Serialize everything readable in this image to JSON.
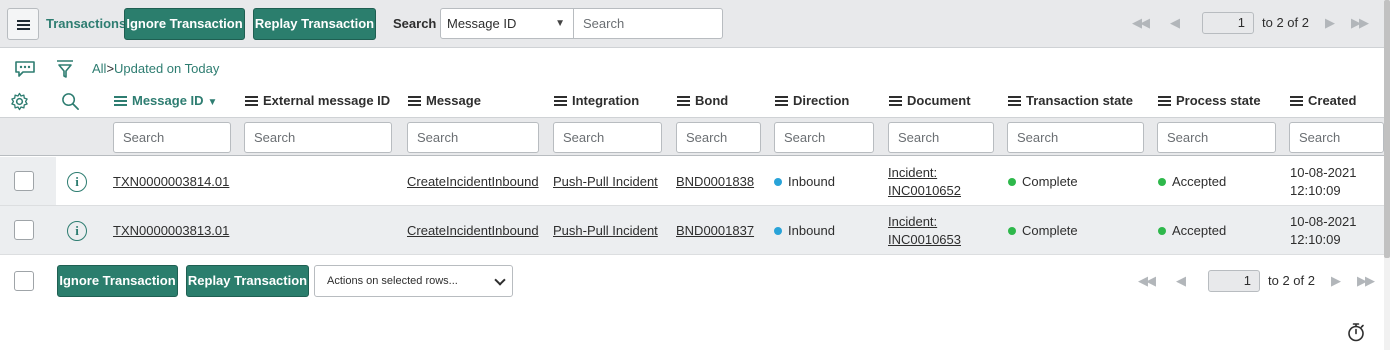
{
  "header": {
    "menu_icon": "hamburger-icon",
    "title": "Transactions",
    "ignore_label": "Ignore Transaction",
    "replay_label": "Replay Transaction",
    "search_label": "Search",
    "search_field_selected": "Message ID",
    "search_placeholder": "Search"
  },
  "pager_top": {
    "current_page": "1",
    "range_text": "to 2 of 2"
  },
  "breadcrumb": {
    "root": "All",
    "separator": ">",
    "filter": "Updated on Today"
  },
  "toolbar_icons": {
    "activity": "chat-bubble-icon",
    "filter": "funnel-icon",
    "settings": "gear-icon",
    "search": "search-icon"
  },
  "columns": [
    {
      "label": "Message ID",
      "sorted": "descending"
    },
    {
      "label": "External message ID"
    },
    {
      "label": "Message"
    },
    {
      "label": "Integration"
    },
    {
      "label": "Bond"
    },
    {
      "label": "Direction"
    },
    {
      "label": "Document"
    },
    {
      "label": "Transaction state"
    },
    {
      "label": "Process state"
    },
    {
      "label": "Created"
    }
  ],
  "column_search_placeholder": "Search",
  "rows": [
    {
      "message_id": "TXN0000003814.01",
      "external_message_id": "",
      "message": "CreateIncidentInbound",
      "integration": "Push-Pull Incident",
      "bond": "BND0001838",
      "direction": "Inbound",
      "document_line1": "Incident:",
      "document_line2": "INC0010652",
      "transaction_state": "Complete",
      "process_state": "Accepted",
      "created_date": "10-08-2021",
      "created_time": "12:10:09"
    },
    {
      "message_id": "TXN0000003813.01",
      "external_message_id": "",
      "message": "CreateIncidentInbound",
      "integration": "Push-Pull Incident",
      "bond": "BND0001837",
      "direction": "Inbound",
      "document_line1": "Incident:",
      "document_line2": "INC0010653",
      "transaction_state": "Complete",
      "process_state": "Accepted",
      "created_date": "10-08-2021",
      "created_time": "12:10:09"
    }
  ],
  "footer": {
    "ignore_label": "Ignore Transaction",
    "replay_label": "Replay Transaction",
    "actions_placeholder": "Actions on selected rows..."
  },
  "pager_bottom": {
    "current_page": "1",
    "range_text": "to 2 of 2"
  },
  "colors": {
    "accent": "#2b7e6d",
    "link_green": "#2e7d71",
    "direction_dot": "#29a3d8",
    "state_dot": "#2eb84b"
  }
}
